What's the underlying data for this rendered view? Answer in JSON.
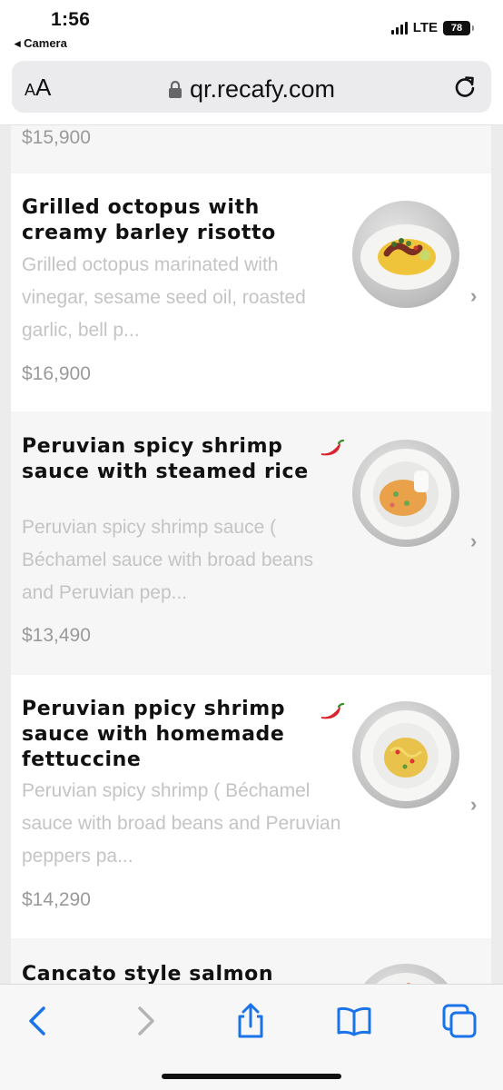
{
  "status": {
    "time": "1:56",
    "back_label": "◂ Camera",
    "network": "LTE",
    "battery": "78"
  },
  "browser": {
    "aa_small": "A",
    "aa_large": "A",
    "url": "qr.recafy.com"
  },
  "menu": {
    "prev_price": "$15,900",
    "items": [
      {
        "name": "Grilled octopus with creamy barley risotto",
        "description": "Grilled octopus marinated with vinegar, sesame seed oil, roasted garlic, bell p...",
        "price": "$16,900",
        "spicy": false
      },
      {
        "name": "Peruvian spicy shrimp sauce with steamed rice",
        "description": "Peruvian spicy shrimp sauce ( Béchamel sauce with broad beans and Peruvian pep...",
        "price": "$13,490",
        "spicy": true
      },
      {
        "name": "Peruvian ppicy shrimp sauce with homemade fettuccine",
        "description": "Peruvian spicy shrimp ( Béchamel sauce with broad beans and Peruvian peppers pa...",
        "price": "$14,290",
        "spicy": true
      },
      {
        "name": "Cancato style salmon"
      }
    ]
  },
  "icons": {
    "lock": "lock-icon",
    "reload": "reload-icon",
    "chevron": "chevron-right-icon",
    "chili": "chili-pepper-icon",
    "back": "back-arrow-icon",
    "forward": "forward-arrow-icon",
    "share": "share-icon",
    "bookmarks": "bookmarks-icon",
    "tabs": "tabs-icon"
  },
  "colors": {
    "accent": "#1a73e8",
    "chili": "#d9232d"
  }
}
